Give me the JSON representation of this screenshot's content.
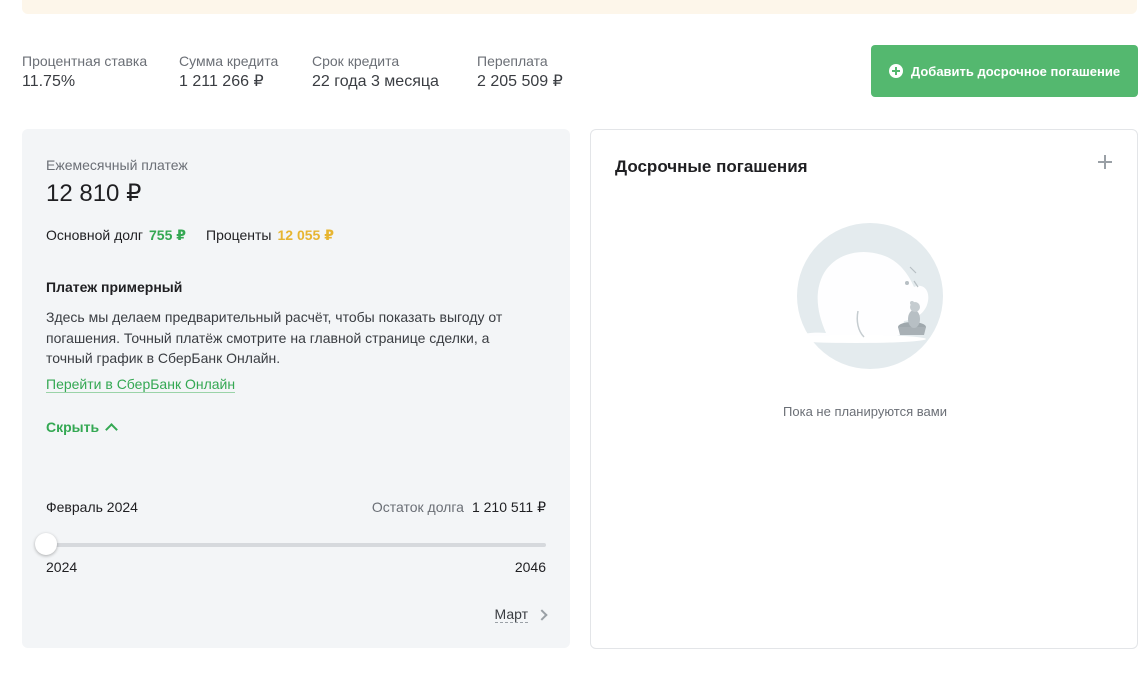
{
  "stats": [
    {
      "label": "Процентная ставка",
      "value": "11.75%"
    },
    {
      "label": "Сумма кредита",
      "value": "1 211 266 ₽"
    },
    {
      "label": "Срок кредита",
      "value": "22 года 3 месяца"
    },
    {
      "label": "Переплата",
      "value": "2 205 509 ₽"
    }
  ],
  "add_button": {
    "label": "Добавить досрочное погашение",
    "icon": "plus-circle-icon"
  },
  "payment": {
    "monthly_label": "Ежемесячный платеж",
    "monthly_value": "12 810 ₽",
    "principal_label": "Основной долг",
    "principal_value": "755 ₽",
    "interest_label": "Проценты",
    "interest_value": "12 055 ₽",
    "approx_title": "Платеж примерный",
    "approx_text": "Здесь мы делаем предварительный расчёт, чтобы показать выгоду от погашения. Точный платёж смотрите на главной странице сделки, а точный график в СберБанк Онлайн.",
    "link": "Перейти в СберБанк Онлайн",
    "hide": "Скрыть"
  },
  "timeline": {
    "month": "Февраль 2024",
    "remain_label": "Остаток долга",
    "remain_value": "1 210 511 ₽",
    "year_start": "2024",
    "year_end": "2046",
    "slider_position": 0,
    "next_month": "Март"
  },
  "early": {
    "title": "Досрочные погашения",
    "empty_text": "Пока не планируются вами"
  },
  "colors": {
    "accent": "#54b86f",
    "principal": "#34a853",
    "interest": "#e7b531",
    "banner": "#fdf6ea"
  }
}
